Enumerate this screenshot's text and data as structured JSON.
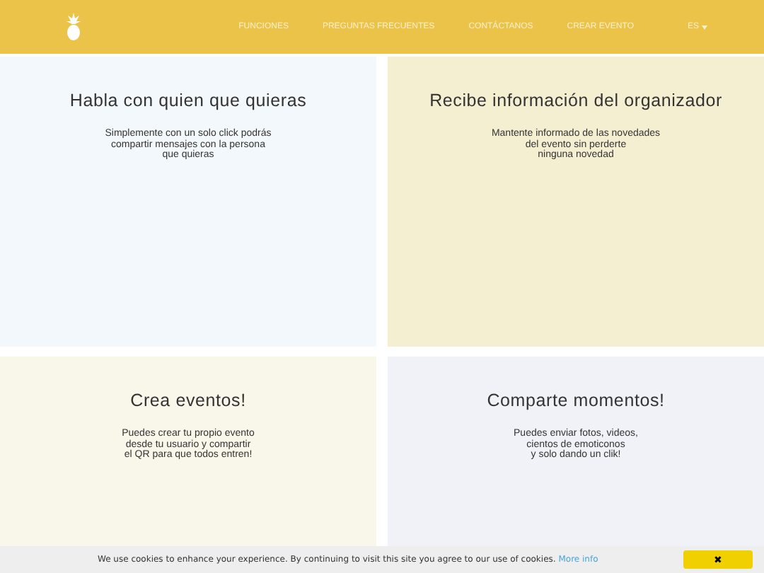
{
  "nav": {
    "items": [
      {
        "label": "FUNCIONES"
      },
      {
        "label": "PREGUNTAS FRECUENTES"
      },
      {
        "label": "CONTÁCTANOS"
      },
      {
        "label": "CREAR EVENTO"
      }
    ],
    "language": "ES"
  },
  "features": [
    {
      "title": "Habla con quien que quieras",
      "text": "Simplemente con un solo click podrás\ncompartir mensajes con la persona\nque quieras",
      "color": "#f2f8fb"
    },
    {
      "title": "Recibe información del organizador",
      "text": "Mantente informado de las novedades\ndel evento sin perderte\nninguna novedad",
      "color": "#f5efd2"
    },
    {
      "title": "Crea eventos!",
      "text": "Puedes crear tu propio evento\ndesde tu usuario y compartir\nel QR para que todos entren!",
      "color": "#f9f6ea"
    },
    {
      "title": "Comparte momentos!",
      "text": "Puedes enviar fotos, videos,\ncientos de emoticonos\ny solo dando un clik!",
      "color": "#f1f2f7"
    }
  ],
  "cookie_bar": {
    "text": "We use cookies to enhance your experience. By continuing to visit this site you agree to our use of cookies.",
    "link": "More info",
    "close": "✖"
  }
}
